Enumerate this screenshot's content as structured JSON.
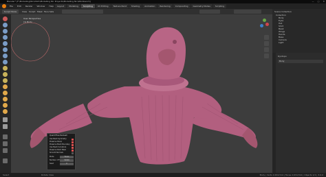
{
  "window": {
    "title": "Blender* [F:\\Modelling\\Nic\\2021\\Modelling Nic Projects\\Modelling Nic\\Workbench]",
    "controls": [
      "—",
      "□",
      "✕"
    ]
  },
  "menu": {
    "items": [
      "File",
      "Edit",
      "Render",
      "Window",
      "Help"
    ],
    "tabs": [
      "Layout",
      "Modeling",
      "Sculpting",
      "UV Editing",
      "Texture Paint",
      "Shading",
      "Animation",
      "Rendering",
      "Compositing",
      "Geometry Nodes",
      "Scripting"
    ],
    "active_tab": "Sculpting"
  },
  "header": {
    "mode": "Sculpt Mode",
    "menus": [
      "View",
      "Sculpt",
      "Mask",
      "Face Sets"
    ]
  },
  "viewport": {
    "overlay_line1": "User Perspective",
    "overlay_line2": "(1) Body"
  },
  "dialog": {
    "title": "QuadriFlow Remesh",
    "options": [
      {
        "label": "Use Mesh Symmetry",
        "checked": true
      },
      {
        "label": "Preserve Sharp",
        "checked": true
      },
      {
        "label": "Preserve Mesh Boundary",
        "checked": true
      },
      {
        "label": "Use Mesh Curvature",
        "checked": true
      },
      {
        "label": "Preserve Paint Mask",
        "checked": true
      },
      {
        "label": "Smooth Normals",
        "checked": false
      }
    ],
    "mode_label": "Mode",
    "mode_value": "Faces",
    "faces_label": "Number of Faces",
    "faces_value": "50000",
    "seed_label": "Seed",
    "seed_value": "0"
  },
  "outliner": {
    "title": "Scene Collection",
    "rows": [
      "Collection",
      "Body",
      "Eyes",
      "Hat",
      "Shirt",
      "Beak",
      "Wings",
      "Hands",
      "Base",
      "Camera",
      "Light"
    ]
  },
  "properties": {
    "header": "Dyntopo",
    "object": "Body"
  },
  "statusbar": {
    "left": "Select",
    "mid": "Rotate View",
    "right": "Body | Verts 2,634,514 | Faces 2,634,512 | Objects 1/1 | 3.0.0"
  },
  "colors": {
    "accent": "#4a7cc7",
    "mesh": "#b25f7f",
    "checkbox": "#d94f4f"
  }
}
